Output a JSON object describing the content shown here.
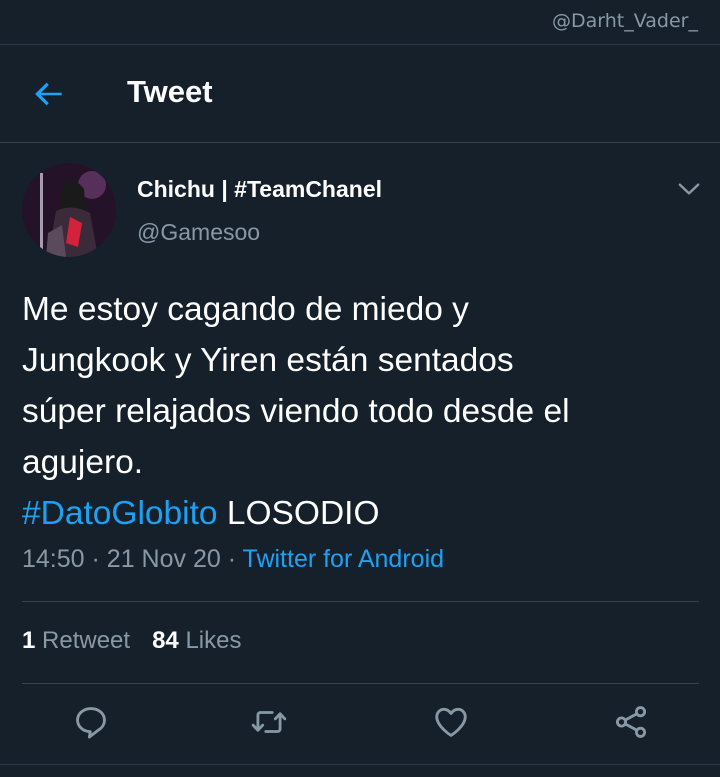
{
  "watermark": "@Darht_Vader_",
  "header": {
    "title": "Tweet",
    "back_icon": "arrow-left-icon"
  },
  "tweet": {
    "author_name": "Chichu | #TeamChanel",
    "author_handle": "@Gamesoo",
    "text_lines": [
      "Me estoy cagando de miedo y",
      "Jungkook y Yiren están sentados",
      "súper relajados viendo todo desde el",
      "agujero."
    ],
    "hashtag": "#DatoGlobito",
    "text_suffix": " LOSODIO",
    "time": "14:50",
    "date": "21 Nov 20",
    "separator": "·",
    "source": "Twitter for Android",
    "retweet_count": "1",
    "retweet_label": "Retweet",
    "like_count": "84",
    "like_label": "Likes"
  },
  "actions": [
    "reply-icon",
    "retweet-icon",
    "like-icon",
    "share-icon"
  ],
  "colors": {
    "background": "#15202b",
    "accent": "#1da1f2",
    "secondary_text": "#8899a6",
    "divider": "#38444d"
  }
}
